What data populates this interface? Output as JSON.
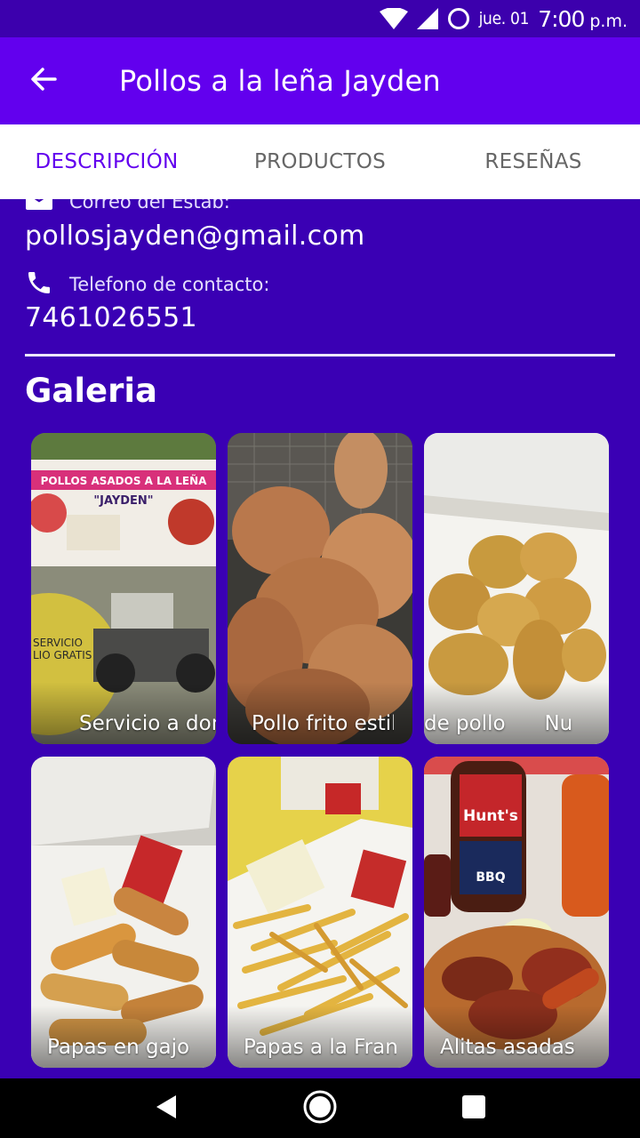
{
  "status_bar": {
    "date": "jue. 01",
    "time": "7:00",
    "ampm": "p.m.",
    "icons": [
      "wifi-icon",
      "signal-icon",
      "battery-circle-icon"
    ]
  },
  "app_bar": {
    "title": "Pollos a la leña Jayden",
    "back_icon": "arrow-back-icon",
    "color": "#6200ee"
  },
  "tabs": {
    "items": [
      "DESCRIPCIÓN",
      "PRODUCTOS",
      "RESEÑAS"
    ],
    "active_index": 0,
    "active_color": "#6200ee"
  },
  "contact": {
    "email_label": "Correo del Estab:",
    "email": "pollosjayden@gmail.com",
    "phone_label": "Telefono de contacto:",
    "phone": "7461026551"
  },
  "gallery": {
    "title": "Galeria",
    "items": [
      {
        "caption": "Servicio a domicilio",
        "sign_title": "POLLOS ASADOS A LA LEÑA",
        "sign_name": "\"JAYDEN\"",
        "sign_service": "SERVICIO",
        "sign_service2": "LIO GRATIS"
      },
      {
        "caption": "Pollo frito estilo"
      },
      {
        "caption": "de pollo      Nu"
      },
      {
        "caption": "Papas en gajo"
      },
      {
        "caption": "Papas a la Francesa"
      },
      {
        "caption": "Alitas asadas",
        "bottle_label": "Hunt's",
        "bottle_sub": "BBQ"
      }
    ]
  },
  "nav_bar": {
    "buttons": [
      "back-triangle-icon",
      "home-circle-icon",
      "recents-square-icon"
    ]
  },
  "colors": {
    "background": "#3a00b4",
    "status_bar": "#3c00ad"
  }
}
